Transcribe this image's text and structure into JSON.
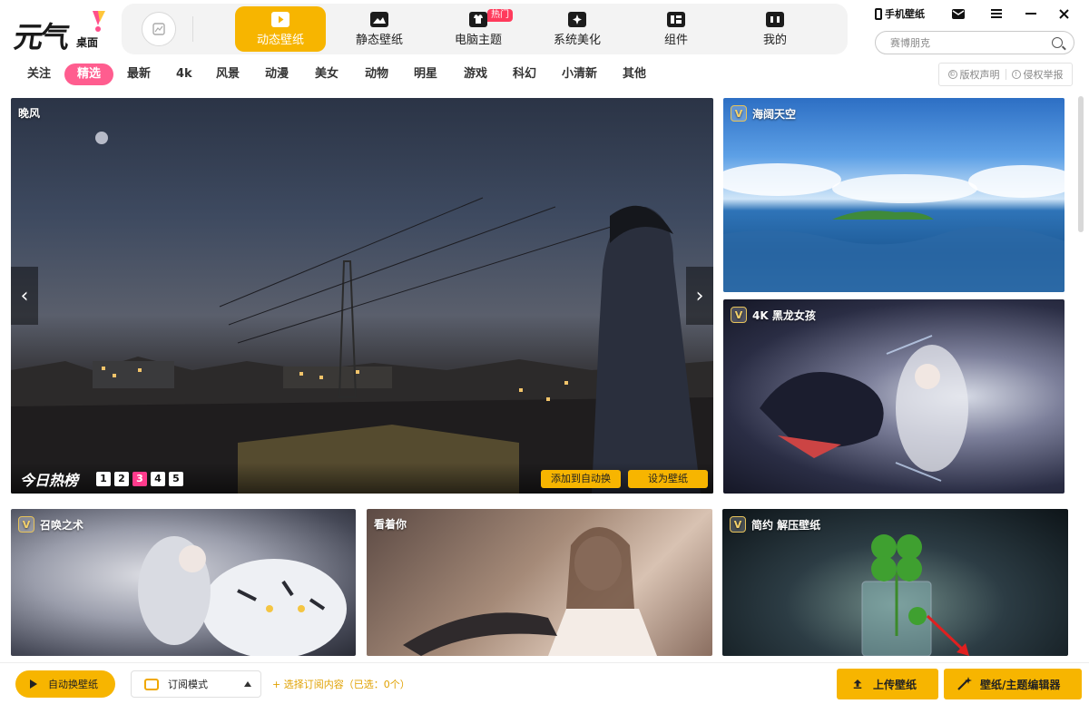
{
  "app": {
    "logo_text": "元气",
    "logo_sub": "桌面"
  },
  "nav": {
    "tabs": [
      {
        "label": "动态壁纸",
        "icon": "play-icon",
        "active": true
      },
      {
        "label": "静态壁纸",
        "icon": "image-icon",
        "active": false
      },
      {
        "label": "电脑主题",
        "icon": "shirt-icon",
        "active": false,
        "badge": "热门"
      },
      {
        "label": "系统美化",
        "icon": "sparkle-icon",
        "active": false
      },
      {
        "label": "组件",
        "icon": "widget-icon",
        "active": false
      },
      {
        "label": "我的",
        "icon": "profile-icon",
        "active": false
      }
    ]
  },
  "top_right": {
    "phone_wallpaper": "手机壁纸",
    "search_placeholder": "赛博朋克"
  },
  "categories": {
    "items": [
      "关注",
      "精选",
      "最新",
      "4k",
      "风景",
      "动漫",
      "美女",
      "动物",
      "明星",
      "游戏",
      "科幻",
      "小清新",
      "其他"
    ],
    "active": "精选",
    "copyright": "版权声明",
    "report": "侵权举报"
  },
  "hero": {
    "title": "晚风",
    "hot_label": "今日热榜",
    "pages": [
      "1",
      "2",
      "3",
      "4",
      "5"
    ],
    "active_page": "3",
    "add_auto": "添加到自动换",
    "set_wallpaper": "设为壁纸"
  },
  "cards": [
    {
      "title": "海阔天空",
      "vip": true
    },
    {
      "title": "4K 黑龙女孩",
      "vip": true
    },
    {
      "title": "召唤之术",
      "vip": true
    },
    {
      "title": "看着你",
      "vip": false
    },
    {
      "title": "简约 解压壁纸",
      "vip": true
    }
  ],
  "vip_badge": "V",
  "footer": {
    "auto_change": "自动换壁纸",
    "sub_mode": "订阅模式",
    "select_sub": "+ 选择订阅内容（已选：0个）",
    "upload": "上传壁纸",
    "editor": "壁纸/主题编辑器"
  },
  "colors": {
    "accent": "#f7b500",
    "category_active": "#ff5d8f",
    "pager_active": "#ff3b8c",
    "hot_badge": "#ff3b5c"
  }
}
